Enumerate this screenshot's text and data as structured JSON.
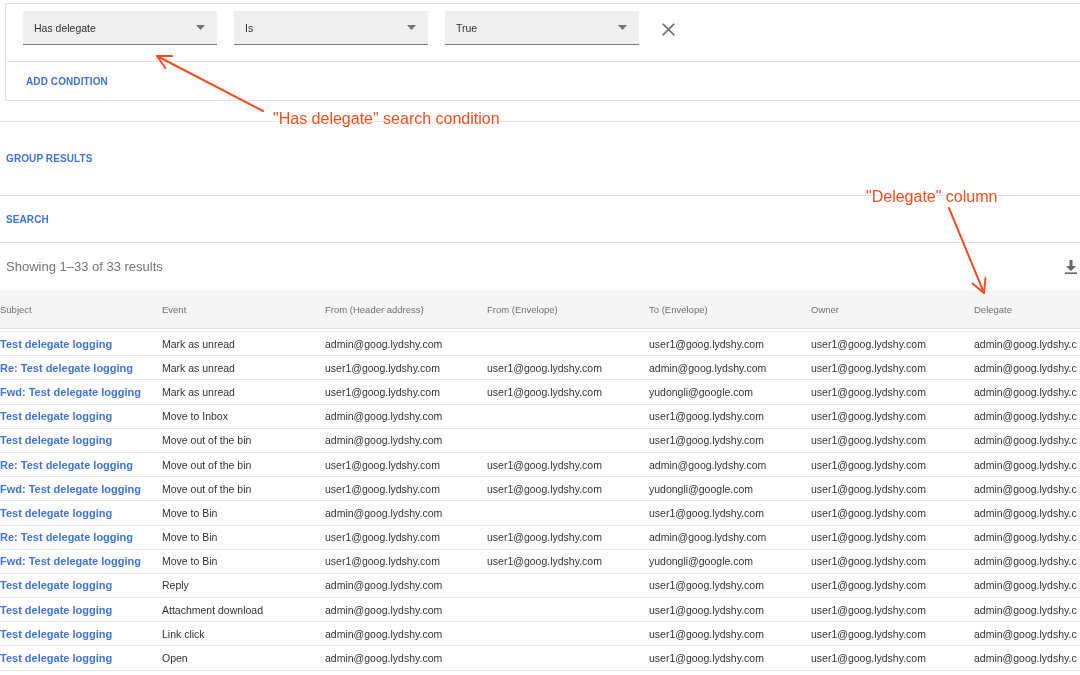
{
  "condition": {
    "fields": [
      {
        "value": "Has delegate"
      },
      {
        "value": "Is"
      },
      {
        "value": "True"
      }
    ],
    "add_condition": "ADD CONDITION"
  },
  "group_results": "GROUP RESULTS",
  "search": "SEARCH",
  "results": {
    "summary": "Showing 1–33 of 33 results"
  },
  "table": {
    "columns": [
      "Subject",
      "Event",
      "From (Header address)",
      "From (Envelope)",
      "To (Envelope)",
      "Owner",
      "Delegate"
    ],
    "rows": [
      {
        "subject": "Test delegate logging",
        "event": "Mark as unread",
        "from_header": "admin@goog.lydshy.com",
        "to_envelope": "user1@goog.lydshy.com",
        "owner": "user1@goog.lydshy.com",
        "delegate": "admin@goog.lydshy.c"
      },
      {
        "subject": "Re: Test delegate logging",
        "event": "Mark as unread",
        "from_header": "user1@goog.lydshy.com",
        "from_envelope": "user1@goog.lydshy.com",
        "to_envelope": "admin@goog.lydshy.com",
        "owner": "user1@goog.lydshy.com",
        "delegate": "admin@goog.lydshy.c"
      },
      {
        "subject": "Fwd: Test delegate logging",
        "event": "Mark as unread",
        "from_header": "user1@goog.lydshy.com",
        "from_envelope": "user1@goog.lydshy.com",
        "to_envelope": "yudongli@google.com",
        "owner": "user1@goog.lydshy.com",
        "delegate": "admin@goog.lydshy.c"
      },
      {
        "subject": "Test delegate logging",
        "event": "Move to Inbox",
        "from_header": "admin@goog.lydshy.com",
        "to_envelope": "user1@goog.lydshy.com",
        "owner": "user1@goog.lydshy.com",
        "delegate": "admin@goog.lydshy.c"
      },
      {
        "subject": "Test delegate logging",
        "event": "Move out of the bin",
        "from_header": "admin@goog.lydshy.com",
        "to_envelope": "user1@goog.lydshy.com",
        "owner": "user1@goog.lydshy.com",
        "delegate": "admin@goog.lydshy.c"
      },
      {
        "subject": "Re: Test delegate logging",
        "event": "Move out of the bin",
        "from_header": "user1@goog.lydshy.com",
        "from_envelope": "user1@goog.lydshy.com",
        "to_envelope": "admin@goog.lydshy.com",
        "owner": "user1@goog.lydshy.com",
        "delegate": "admin@goog.lydshy.c"
      },
      {
        "subject": "Fwd: Test delegate logging",
        "event": "Move out of the bin",
        "from_header": "user1@goog.lydshy.com",
        "from_envelope": "user1@goog.lydshy.com",
        "to_envelope": "yudongli@google.com",
        "owner": "user1@goog.lydshy.com",
        "delegate": "admin@goog.lydshy.c"
      },
      {
        "subject": "Test delegate logging",
        "event": "Move to Bin",
        "from_header": "admin@goog.lydshy.com",
        "to_envelope": "user1@goog.lydshy.com",
        "owner": "user1@goog.lydshy.com",
        "delegate": "admin@goog.lydshy.c"
      },
      {
        "subject": "Re: Test delegate logging",
        "event": "Move to Bin",
        "from_header": "user1@goog.lydshy.com",
        "from_envelope": "user1@goog.lydshy.com",
        "to_envelope": "admin@goog.lydshy.com",
        "owner": "user1@goog.lydshy.com",
        "delegate": "admin@goog.lydshy.c"
      },
      {
        "subject": "Fwd: Test delegate logging",
        "event": "Move to Bin",
        "from_header": "user1@goog.lydshy.com",
        "from_envelope": "user1@goog.lydshy.com",
        "to_envelope": "yudongli@google.com",
        "owner": "user1@goog.lydshy.com",
        "delegate": "admin@goog.lydshy.c"
      },
      {
        "subject": "Test delegate logging",
        "event": "Reply",
        "from_header": "admin@goog.lydshy.com",
        "to_envelope": "user1@goog.lydshy.com",
        "owner": "user1@goog.lydshy.com",
        "delegate": "admin@goog.lydshy.c"
      },
      {
        "subject": "Test delegate logging",
        "event": "Attachment download",
        "from_header": "admin@goog.lydshy.com",
        "to_envelope": "user1@goog.lydshy.com",
        "owner": "user1@goog.lydshy.com",
        "delegate": "admin@goog.lydshy.c"
      },
      {
        "subject": "Test delegate logging",
        "event": "Link click",
        "from_header": "admin@goog.lydshy.com",
        "to_envelope": "user1@goog.lydshy.com",
        "owner": "user1@goog.lydshy.com",
        "delegate": "admin@goog.lydshy.c"
      },
      {
        "subject": "Test delegate logging",
        "event": "Open",
        "from_header": "admin@goog.lydshy.com",
        "to_envelope": "user1@goog.lydshy.com",
        "owner": "user1@goog.lydshy.com",
        "delegate": "admin@goog.lydshy.c"
      }
    ]
  },
  "annotations": [
    {
      "text": "\"Has delegate\" search condition"
    },
    {
      "text": "\"Delegate\" column"
    }
  ]
}
